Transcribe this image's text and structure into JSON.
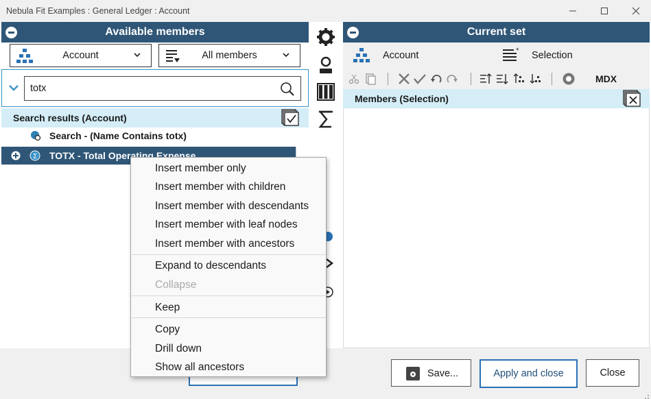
{
  "window": {
    "title": "Nebula Fit Examples : General Ledger : Account"
  },
  "left": {
    "header": "Available members",
    "dimension_dropdown": "Account",
    "filter_dropdown": "All members",
    "search_value": "totx",
    "results_header": "Search results (Account)",
    "rows": [
      {
        "label": "Search - (Name Contains totx)"
      },
      {
        "label": "TOTX - Total Operating Expense"
      }
    ]
  },
  "middle": {
    "icons": [
      "gear-icon",
      "person-icon",
      "columns-icon",
      "sigma-icon"
    ]
  },
  "right": {
    "header": "Current set",
    "dimension_label": "Account",
    "selection_label": "Selection",
    "mdx_label": "MDX",
    "members_header": "Members (Selection)"
  },
  "context_menu": {
    "items": [
      {
        "label": "Insert member only",
        "enabled": true
      },
      {
        "label": "Insert member with children",
        "enabled": true
      },
      {
        "label": "Insert member with descendants",
        "enabled": true
      },
      {
        "label": "Insert member with leaf nodes",
        "enabled": true
      },
      {
        "label": "Insert member with ancestors",
        "enabled": true
      },
      {
        "label": "Expand to descendants",
        "enabled": true
      },
      {
        "label": "Collapse",
        "enabled": false
      },
      {
        "label": "Keep",
        "enabled": true
      },
      {
        "label": "Copy",
        "enabled": true
      },
      {
        "label": "Drill down",
        "enabled": true
      },
      {
        "label": "Show all ancestors",
        "enabled": true
      }
    ]
  },
  "buttons": {
    "save": "Save...",
    "apply": "Apply and close",
    "close": "Close"
  },
  "colors": {
    "header_bg": "#2f5677",
    "highlight_bg": "#d4edf7",
    "accent": "#3a93c7",
    "primary_border": "#2a71b5"
  }
}
